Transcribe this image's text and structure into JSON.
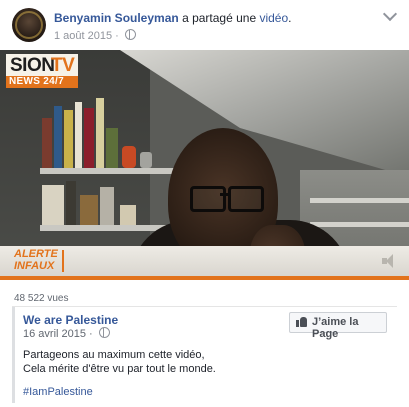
{
  "post": {
    "author": "Benyamin Souleyman",
    "verb": "a partagé une",
    "object_link": "vidéo",
    "object_suffix": ".",
    "date": "1 août 2015 ·"
  },
  "video": {
    "channel_logo_main": "SION",
    "channel_logo_tv": "TV",
    "channel_logo_sub": "NEWS 24/7",
    "ticker_label_line1": "ALERTE",
    "ticker_label_line2": "INFAUX",
    "colors": {
      "brand_orange": "#e2731c"
    }
  },
  "views": "48 522 vues",
  "shared_post": {
    "page_name": "We are Palestine",
    "date": "16 avril 2015 ·",
    "like_button": "J’aime la Page",
    "text_line1": "Partageons au maximum cette vidéo,",
    "text_line2": "Cela mérite d'être vu par tout le monde.",
    "hashtag": "#IamPalestine"
  },
  "colors": {
    "link_blue": "#365899",
    "text": "#1d2129",
    "muted": "#90949c"
  }
}
